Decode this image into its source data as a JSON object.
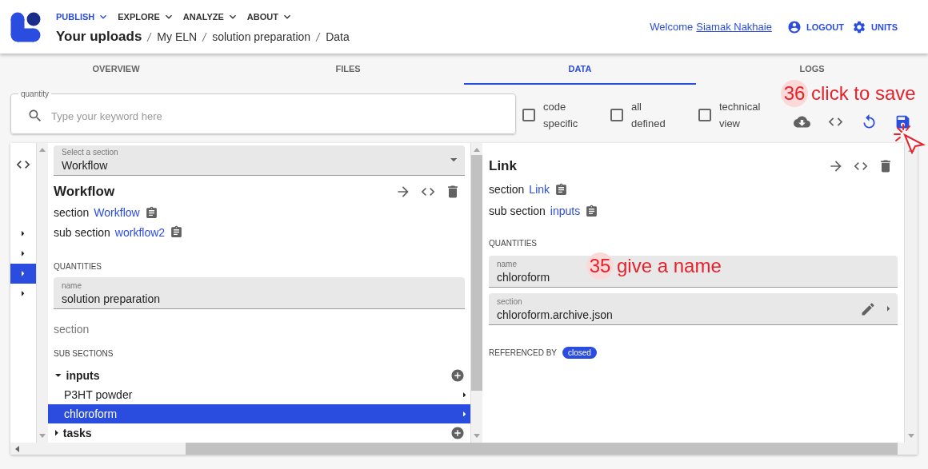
{
  "header": {
    "nav": [
      {
        "label": "PUBLISH",
        "selected": true
      },
      {
        "label": "EXPLORE",
        "selected": false
      },
      {
        "label": "ANALYZE",
        "selected": false
      },
      {
        "label": "ABOUT",
        "selected": false
      }
    ],
    "breadcrumb": [
      "Your uploads",
      "My ELN",
      "solution preparation",
      "Data"
    ],
    "welcome": "Welcome",
    "user": "Siamak Nakhaie",
    "actions": [
      "LOGOUT",
      "UNITS"
    ]
  },
  "tabs": [
    {
      "label": "OVERVIEW",
      "selected": false
    },
    {
      "label": "FILES",
      "selected": false
    },
    {
      "label": "DATA",
      "selected": true
    },
    {
      "label": "LOGS",
      "selected": false
    }
  ],
  "toolbar": {
    "search": {
      "label": "quantity",
      "placeholder": "Type your keyword here"
    },
    "checkboxes": [
      {
        "label": "code specific",
        "checked": false
      },
      {
        "label": "all defined",
        "checked": false
      },
      {
        "label": "technical view",
        "checked": false
      }
    ]
  },
  "browser": {
    "lane_1": {
      "rows": [
        {
          "selected": false
        },
        {
          "selected": false
        },
        {
          "selected": true
        },
        {
          "selected": false
        }
      ]
    },
    "section_lane": {
      "select": {
        "label": "Select a section",
        "value": "Workflow"
      },
      "title": "Workflow",
      "section_label": "section",
      "section_link": "Workflow",
      "sub_section_label": "sub section",
      "sub_section_link": "workflow2",
      "quantities_heading": "QUANTITIES",
      "fields": [
        {
          "label": "name",
          "value": "solution preparation"
        }
      ],
      "empty_quantity": "section",
      "sub_sections_heading": "SUB SECTIONS",
      "sub_sections": [
        {
          "label": "inputs",
          "expanded": true,
          "children": [
            {
              "label": "P3HT powder",
              "selected": false
            },
            {
              "label": "chloroform",
              "selected": true
            }
          ]
        },
        {
          "label": "tasks",
          "expanded": false
        }
      ]
    },
    "link_lane": {
      "title": "Link",
      "section_label": "section",
      "section_link": "Link",
      "sub_section_label": "sub section",
      "sub_section_link": "inputs",
      "quantities_heading": "QUANTITIES",
      "fields": [
        {
          "kind": "text",
          "label": "name",
          "value": "chloroform"
        },
        {
          "kind": "reference",
          "label": "section",
          "value": "chloroform.archive.json"
        }
      ],
      "referenced_by": "REFERENCED BY",
      "reference_chip": "closed"
    }
  },
  "annotations": [
    {
      "number": "36",
      "text": "click to save"
    },
    {
      "number": "35",
      "text": "give a name"
    }
  ]
}
